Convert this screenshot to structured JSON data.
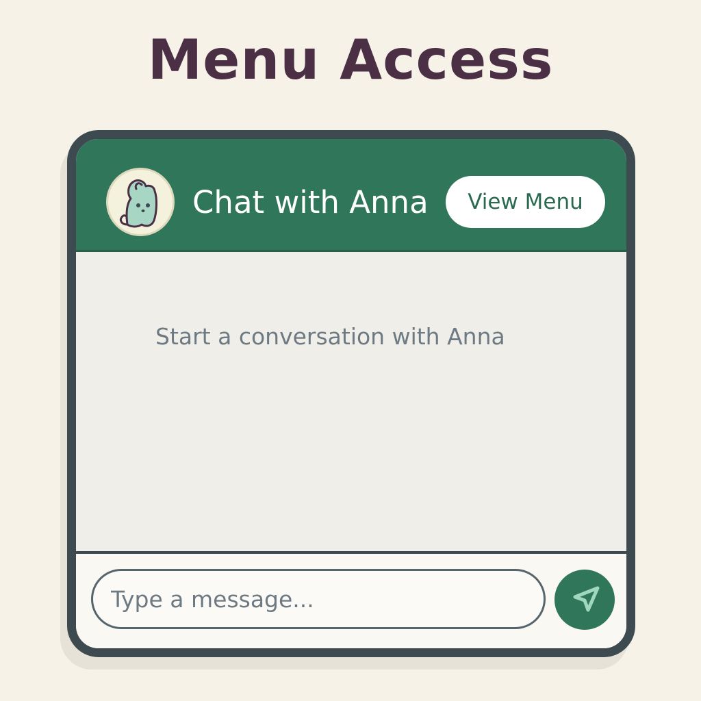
{
  "page": {
    "title": "Menu Access"
  },
  "header": {
    "title": "Chat with Anna",
    "avatar_icon": "ghost-avatar-icon",
    "view_menu_label": "View Menu"
  },
  "body": {
    "empty_state": "Start a conversation with Anna"
  },
  "composer": {
    "placeholder": "Type a message...",
    "send_icon": "send-icon"
  },
  "colors": {
    "background": "#f6f2e8",
    "title_text": "#4a2f45",
    "header_green": "#2f765a",
    "frame_border": "#3d4a50",
    "body_background": "#f0eee8",
    "muted_text": "#6e7a83",
    "button_background": "#ffffff",
    "button_text": "#2a6a50"
  }
}
